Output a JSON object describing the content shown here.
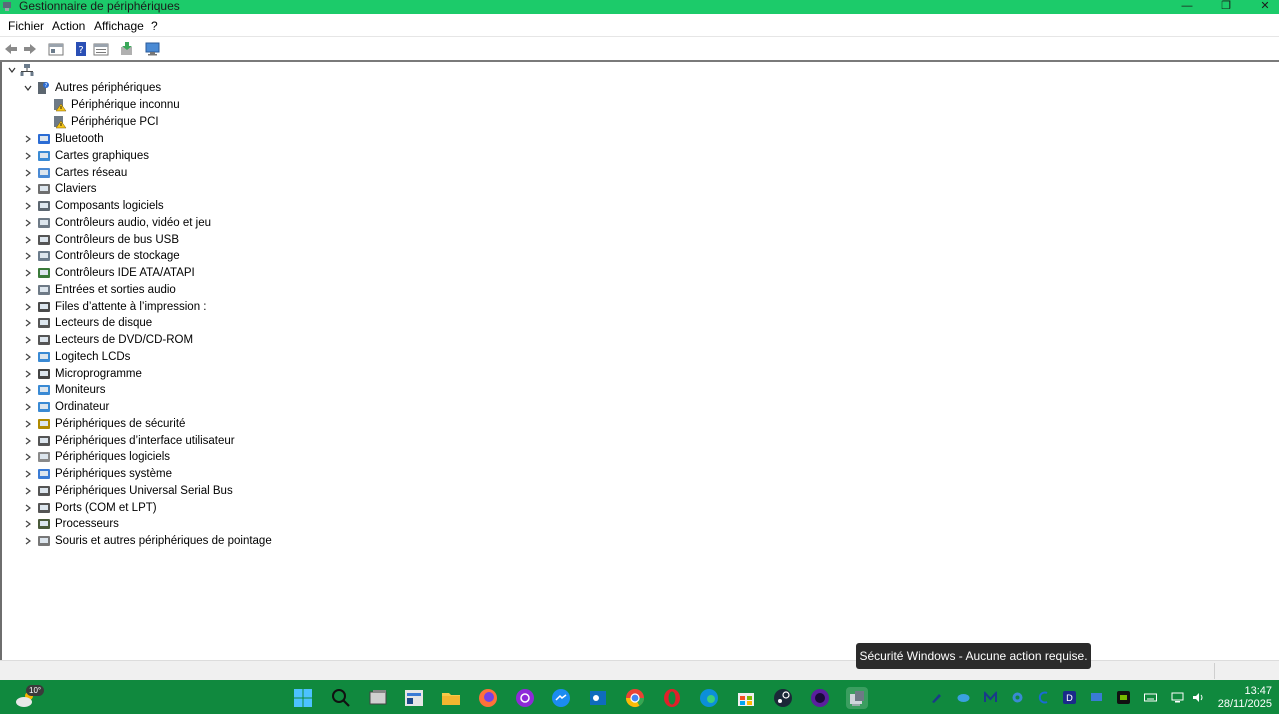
{
  "window": {
    "title": "Gestionnaire de périphériques",
    "controls": {
      "minimize": "—",
      "maximize": "❐",
      "close": "✕"
    }
  },
  "menu": [
    "Fichier",
    "Action",
    "Affichage",
    "?"
  ],
  "toolbar": {
    "buttons": [
      "back-icon",
      "forward-icon",
      "properties-icon",
      "help-icon",
      "view-icon",
      "update-driver-icon",
      "scan-hardware-icon"
    ]
  },
  "tree": {
    "root_icon": "computer-network-icon",
    "expanded_category": {
      "label": "Autres périphériques",
      "children": [
        "Périphérique inconnu",
        "Périphérique PCI"
      ]
    },
    "categories": [
      "Bluetooth",
      "Cartes graphiques",
      "Cartes réseau",
      "Claviers",
      "Composants logiciels",
      "Contrôleurs audio, vidéo et jeu",
      "Contrôleurs de bus USB",
      "Contrôleurs de stockage",
      "Contrôleurs IDE ATA/ATAPI",
      "Entrées et sorties audio",
      "Files d’attente à l’impression :",
      "Lecteurs de disque",
      "Lecteurs de DVD/CD-ROM",
      "Logitech LCDs",
      "Microprogramme",
      "Moniteurs",
      "Ordinateur",
      "Périphériques de sécurité",
      "Périphériques d’interface utilisateur",
      "Périphériques logiciels",
      "Périphériques système",
      "Périphériques Universal Serial Bus",
      "Ports (COM et LPT)",
      "Processeurs",
      "Souris et autres périphériques de pointage"
    ]
  },
  "toast": {
    "text": "Sécurité Windows - Aucune action requise."
  },
  "taskbar": {
    "weather_temp": "10°",
    "clock": {
      "time": "13:47",
      "date": "28/11/2025"
    },
    "apps": [
      "start-icon",
      "search-icon",
      "task-view-icon",
      "file-manager-icon",
      "folder-icon",
      "firefox-icon",
      "podcast-icon",
      "messenger-icon",
      "outlook-icon",
      "chrome-icon",
      "opera-icon",
      "edge-icon",
      "store-icon",
      "steam-icon",
      "circle-app-icon",
      "device-manager-icon"
    ],
    "colors": {
      "accent": "#1ccb6a",
      "taskbar": "#10893e"
    }
  }
}
